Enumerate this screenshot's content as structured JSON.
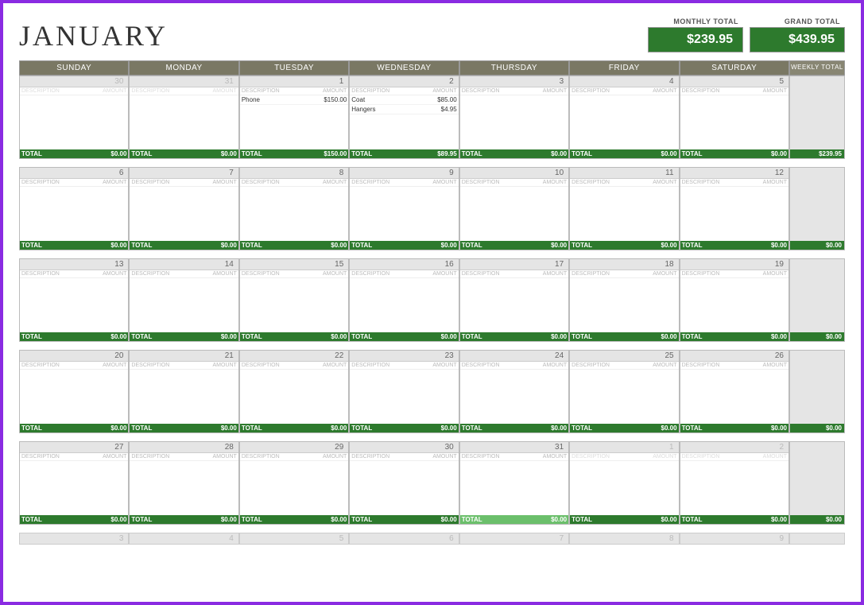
{
  "title": "JANUARY",
  "totals": {
    "monthly_label": "MONTHLY TOTAL",
    "monthly_value": "$239.95",
    "grand_label": "GRAND TOTAL",
    "grand_value": "$439.95"
  },
  "day_headers": [
    "SUNDAY",
    "MONDAY",
    "TUESDAY",
    "WEDNESDAY",
    "THURSDAY",
    "FRIDAY",
    "SATURDAY"
  ],
  "weekly_header": "WEEKLY TOTAL",
  "col_desc": "DESCRIPTION",
  "col_amt": "AMOUNT",
  "total_label": "TOTAL",
  "weeks": [
    {
      "days": [
        {
          "date": "30",
          "faded": true,
          "entries": [],
          "total": "$0.00"
        },
        {
          "date": "31",
          "faded": true,
          "entries": [],
          "total": "$0.00"
        },
        {
          "date": "1",
          "faded": false,
          "entries": [
            {
              "d": "Phone",
              "a": "$150.00"
            }
          ],
          "total": "$150.00"
        },
        {
          "date": "2",
          "faded": false,
          "entries": [
            {
              "d": "Coat",
              "a": "$85.00"
            },
            {
              "d": "Hangers",
              "a": "$4.95"
            }
          ],
          "total": "$89.95"
        },
        {
          "date": "3",
          "faded": false,
          "entries": [],
          "total": "$0.00"
        },
        {
          "date": "4",
          "faded": false,
          "entries": [],
          "total": "$0.00"
        },
        {
          "date": "5",
          "faded": false,
          "entries": [],
          "total": "$0.00"
        }
      ],
      "week_total": "$239.95"
    },
    {
      "days": [
        {
          "date": "6",
          "faded": false,
          "entries": [],
          "total": "$0.00"
        },
        {
          "date": "7",
          "faded": false,
          "entries": [],
          "total": "$0.00"
        },
        {
          "date": "8",
          "faded": false,
          "entries": [],
          "total": "$0.00"
        },
        {
          "date": "9",
          "faded": false,
          "entries": [],
          "total": "$0.00"
        },
        {
          "date": "10",
          "faded": false,
          "entries": [],
          "total": "$0.00"
        },
        {
          "date": "11",
          "faded": false,
          "entries": [],
          "total": "$0.00"
        },
        {
          "date": "12",
          "faded": false,
          "entries": [],
          "total": "$0.00"
        }
      ],
      "week_total": "$0.00"
    },
    {
      "days": [
        {
          "date": "13",
          "faded": false,
          "entries": [],
          "total": "$0.00"
        },
        {
          "date": "14",
          "faded": false,
          "entries": [],
          "total": "$0.00"
        },
        {
          "date": "15",
          "faded": false,
          "entries": [],
          "total": "$0.00"
        },
        {
          "date": "16",
          "faded": false,
          "entries": [],
          "total": "$0.00"
        },
        {
          "date": "17",
          "faded": false,
          "entries": [],
          "total": "$0.00"
        },
        {
          "date": "18",
          "faded": false,
          "entries": [],
          "total": "$0.00"
        },
        {
          "date": "19",
          "faded": false,
          "entries": [],
          "total": "$0.00"
        }
      ],
      "week_total": "$0.00"
    },
    {
      "days": [
        {
          "date": "20",
          "faded": false,
          "entries": [],
          "total": "$0.00"
        },
        {
          "date": "21",
          "faded": false,
          "entries": [],
          "total": "$0.00"
        },
        {
          "date": "22",
          "faded": false,
          "entries": [],
          "total": "$0.00"
        },
        {
          "date": "23",
          "faded": false,
          "entries": [],
          "total": "$0.00"
        },
        {
          "date": "24",
          "faded": false,
          "entries": [],
          "total": "$0.00"
        },
        {
          "date": "25",
          "faded": false,
          "entries": [],
          "total": "$0.00"
        },
        {
          "date": "26",
          "faded": false,
          "entries": [],
          "total": "$0.00"
        }
      ],
      "week_total": "$0.00"
    },
    {
      "days": [
        {
          "date": "27",
          "faded": false,
          "entries": [],
          "total": "$0.00"
        },
        {
          "date": "28",
          "faded": false,
          "entries": [],
          "total": "$0.00"
        },
        {
          "date": "29",
          "faded": false,
          "entries": [],
          "total": "$0.00"
        },
        {
          "date": "30",
          "faded": false,
          "entries": [],
          "total": "$0.00"
        },
        {
          "date": "31",
          "faded": false,
          "entries": [],
          "total": "$0.00",
          "hl": true
        },
        {
          "date": "1",
          "faded": true,
          "entries": [],
          "total": "$0.00"
        },
        {
          "date": "2",
          "faded": true,
          "entries": [],
          "total": "$0.00"
        }
      ],
      "week_total": "$0.00"
    }
  ],
  "trailing": [
    "3",
    "4",
    "5",
    "6",
    "7",
    "8",
    "9"
  ]
}
